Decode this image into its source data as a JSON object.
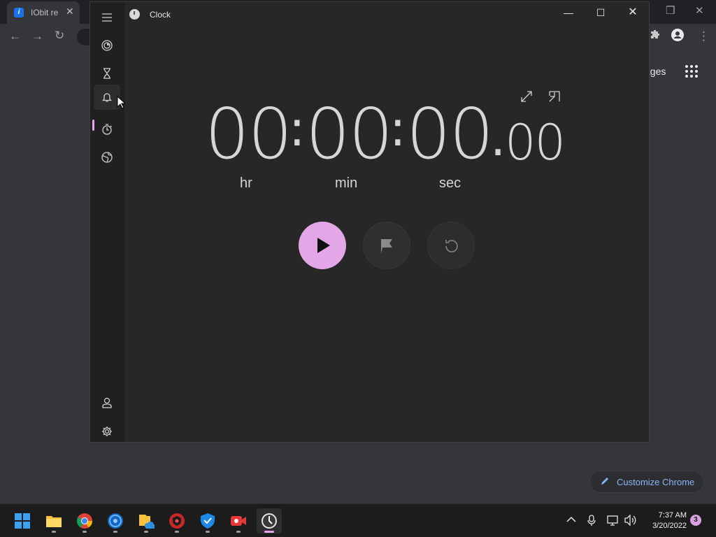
{
  "chrome": {
    "tab_title": "IObit re",
    "tab_favicon_text": "i",
    "tab_close": "✕",
    "images_link": "ages",
    "customize_label": "Customize Chrome"
  },
  "clock": {
    "window_title": "Clock",
    "minimize": "—",
    "maximize": "☐",
    "close": "✕",
    "nav": [
      {
        "name": "focus-sessions",
        "icon": "focus-icon"
      },
      {
        "name": "timer",
        "icon": "hourglass-icon"
      },
      {
        "name": "alarm",
        "icon": "bell-icon"
      },
      {
        "name": "stopwatch",
        "icon": "stopwatch-icon",
        "selected": true
      },
      {
        "name": "world-clock",
        "icon": "globe-icon"
      },
      {
        "name": "account",
        "icon": "person-icon"
      },
      {
        "name": "settings",
        "icon": "gear-icon"
      }
    ],
    "stopwatch": {
      "hours": "00",
      "minutes": "00",
      "seconds": "00",
      "hundredths": "00",
      "sep": ":",
      "decimal": ".",
      "unit_hr": "hr",
      "unit_min": "min",
      "unit_sec": "sec"
    },
    "accent": "#e3a7e7"
  },
  "taskbar": {
    "time": "7:37 AM",
    "date": "3/20/2022",
    "notification_count": "3",
    "apps": [
      "start",
      "file-explorer",
      "chrome",
      "iobit-app",
      "onedrive-files",
      "security-app",
      "shield-app",
      "video-app",
      "clock"
    ]
  }
}
